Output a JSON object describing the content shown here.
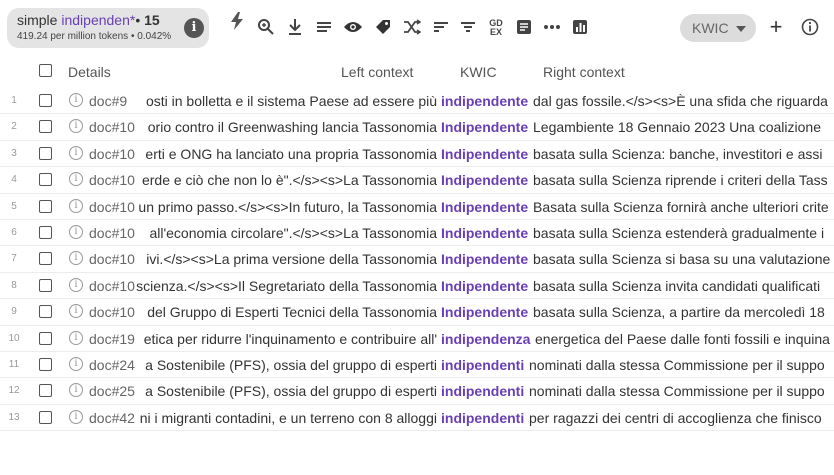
{
  "query": {
    "type": "simple",
    "text": "indipenden*",
    "separator": "•",
    "hits": "15",
    "stats": "419.24 per million tokens • 0.042%"
  },
  "toolbar": {
    "icons": [
      "bolt-icon",
      "search-plus-icon",
      "download-icon",
      "list-icon",
      "eye-icon",
      "tag-icon",
      "shuffle-icon",
      "sort-icon",
      "filter-icon",
      "gdex-icon",
      "document-icon",
      "more-icon",
      "bar-chart-icon",
      "plus-icon",
      "info-icon"
    ],
    "gdex_label": "GD\nEX",
    "view_mode": "KWIC",
    "plus": "+",
    "info": "i"
  },
  "columns": {
    "details": "Details",
    "left": "Left context",
    "kwic": "KWIC",
    "right": "Right context"
  },
  "rows": [
    {
      "n": "1",
      "doc": "doc#9",
      "left": "osti in bolletta e il sistema Paese ad essere più",
      "kwic": "indipendente",
      "right": "dal gas fossile.</s><s>È una sfida che riguarda"
    },
    {
      "n": "2",
      "doc": "doc#10",
      "left": "orio contro il Greenwashing lancia Tassonomia",
      "kwic": "Indipendente",
      "right": "Legambiente 18 Gennaio 2023 Una coalizione"
    },
    {
      "n": "3",
      "doc": "doc#10",
      "left": "erti e ONG ha lanciato una propria Tassonomia",
      "kwic": "Indipendente",
      "right": "basata sulla Scienza: banche, investitori e assi"
    },
    {
      "n": "4",
      "doc": "doc#10",
      "left": "erde e ciò che non lo è\".</s><s>La Tassonomia",
      "kwic": "Indipendente",
      "right": "basata sulla Scienza riprende i criteri della Tass"
    },
    {
      "n": "5",
      "doc": "doc#10",
      "left": "un primo passo.</s><s>In futuro, la Tassonomia",
      "kwic": "Indipendente",
      "right": "Basata sulla Scienza fornirà anche ulteriori crite"
    },
    {
      "n": "6",
      "doc": "doc#10",
      "left": "all'economia circolare\".</s><s>La Tassonomia",
      "kwic": "Indipendente",
      "right": "basata sulla Scienza estenderà gradualmente i"
    },
    {
      "n": "7",
      "doc": "doc#10",
      "left": "ivi.</s><s>La prima versione della Tassonomia",
      "kwic": "Indipendente",
      "right": "basata sulla Scienza si basa su una valutazione"
    },
    {
      "n": "8",
      "doc": "doc#10",
      "left": "scienza.</s><s>Il Segretariato della Tassonomia",
      "kwic": "Indipendente",
      "right": "basata sulla Scienza invita candidati qualificati"
    },
    {
      "n": "9",
      "doc": "doc#10",
      "left": "del Gruppo di Esperti Tecnici della Tassonomia",
      "kwic": "Indipendente",
      "right": "basata sulla Scienza, a partire da mercoledì 18"
    },
    {
      "n": "10",
      "doc": "doc#19",
      "left": "etica per ridurre l'inquinamento e contribuire all'",
      "kwic": "indipendenza",
      "right": "energetica del Paese dalle fonti fossili e inquina"
    },
    {
      "n": "11",
      "doc": "doc#24",
      "left": "a Sostenibile (PFS), ossia del gruppo di esperti",
      "kwic": "indipendenti",
      "right": "nominati dalla stessa Commissione per il suppo"
    },
    {
      "n": "12",
      "doc": "doc#25",
      "left": "a Sostenibile (PFS), ossia del gruppo di esperti",
      "kwic": "indipendenti",
      "right": "nominati dalla stessa Commissione per il suppo"
    },
    {
      "n": "13",
      "doc": "doc#42",
      "left": "ni i migranti contadini, e un terreno con 8 alloggi",
      "kwic": "indipendenti",
      "right": "per ragazzi dei centri di accoglienza che finisco"
    }
  ]
}
